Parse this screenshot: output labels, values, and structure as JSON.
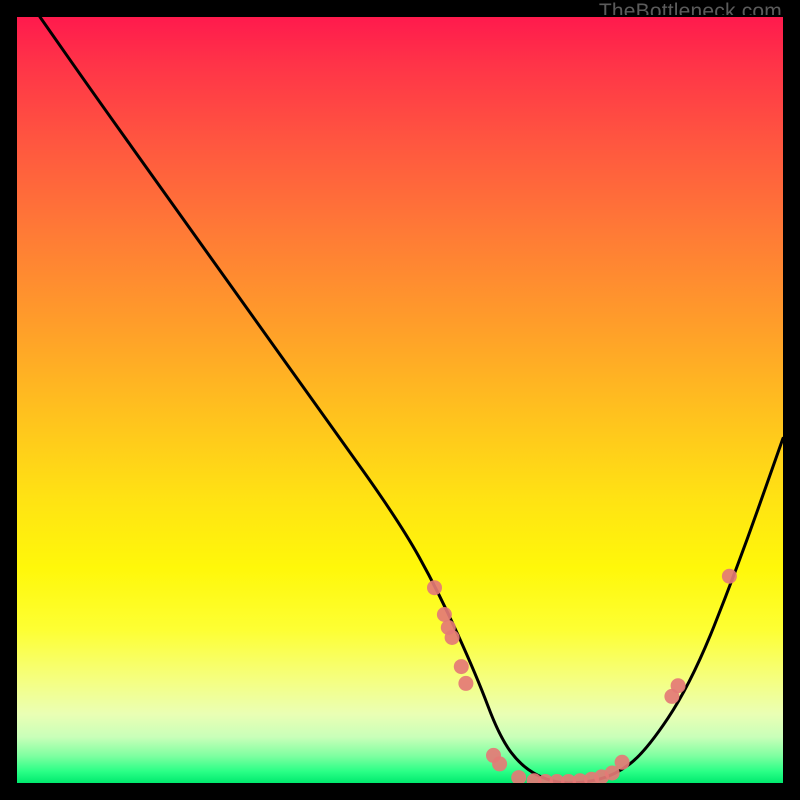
{
  "watermark": "TheBottleneck.com",
  "chart_data": {
    "type": "line",
    "title": "",
    "xlabel": "",
    "ylabel": "",
    "xlim": [
      0,
      100
    ],
    "ylim": [
      0,
      100
    ],
    "grid": false,
    "legend": false,
    "series": [
      {
        "name": "bottleneck-curve",
        "x": [
          3,
          10,
          20,
          30,
          40,
          50,
          55,
          60,
          63,
          66,
          70,
          74,
          78,
          82,
          88,
          94,
          100
        ],
        "y": [
          100,
          90,
          76,
          62,
          48,
          34,
          25,
          14,
          6,
          2,
          0,
          0,
          1,
          4,
          13,
          28,
          45
        ]
      }
    ],
    "markers": {
      "name": "sample-points",
      "color": "#e47a76",
      "points": [
        {
          "x": 54.5,
          "y": 25.5
        },
        {
          "x": 55.8,
          "y": 22.0
        },
        {
          "x": 56.3,
          "y": 20.3
        },
        {
          "x": 56.8,
          "y": 19.0
        },
        {
          "x": 58.0,
          "y": 15.2
        },
        {
          "x": 58.6,
          "y": 13.0
        },
        {
          "x": 62.2,
          "y": 3.6
        },
        {
          "x": 63.0,
          "y": 2.5
        },
        {
          "x": 65.5,
          "y": 0.7
        },
        {
          "x": 67.5,
          "y": 0.3
        },
        {
          "x": 69.0,
          "y": 0.2
        },
        {
          "x": 70.5,
          "y": 0.2
        },
        {
          "x": 72.0,
          "y": 0.2
        },
        {
          "x": 73.5,
          "y": 0.3
        },
        {
          "x": 75.0,
          "y": 0.5
        },
        {
          "x": 76.3,
          "y": 0.8
        },
        {
          "x": 77.7,
          "y": 1.3
        },
        {
          "x": 79.0,
          "y": 2.7
        },
        {
          "x": 85.5,
          "y": 11.3
        },
        {
          "x": 86.3,
          "y": 12.7
        },
        {
          "x": 93.0,
          "y": 27.0
        }
      ]
    }
  }
}
